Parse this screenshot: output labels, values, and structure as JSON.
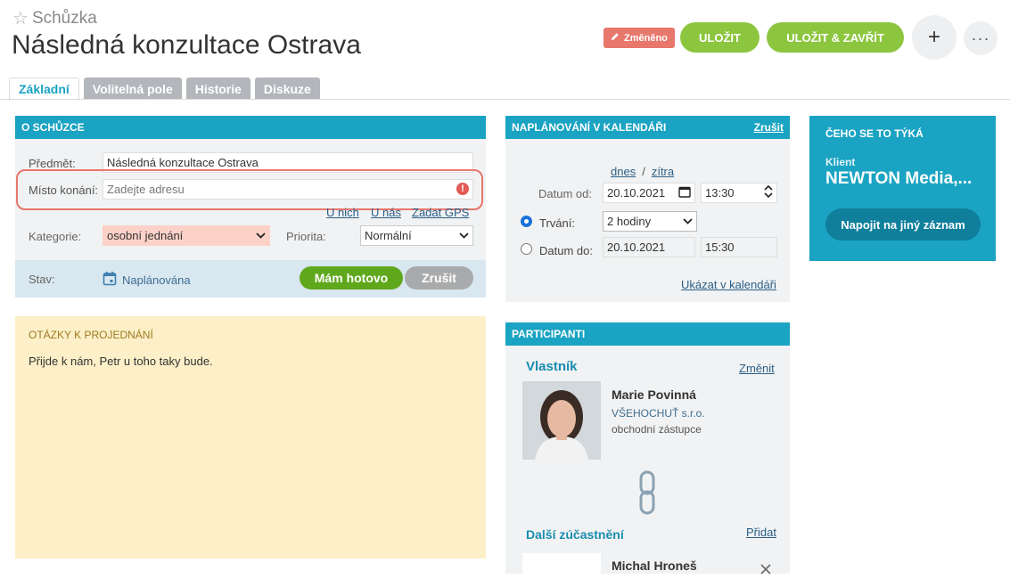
{
  "header": {
    "entity_type": "Schůzka",
    "title": "Následná konzultace Ostrava",
    "changed_badge": "Změněno",
    "save_label": "ULOŽIT",
    "save_close_label": "ULOŽIT & ZAVŘÍT",
    "plus_label": "+",
    "more_label": "···"
  },
  "tabs": [
    {
      "label": "Základní",
      "active": true
    },
    {
      "label": "Volitelná pole",
      "active": false
    },
    {
      "label": "Historie",
      "active": false
    },
    {
      "label": "Diskuze",
      "active": false
    }
  ],
  "meeting": {
    "heading": "O SCHŮZCE",
    "subject_label": "Předmět:",
    "subject_value": "Následná konzultace Ostrava",
    "place_label": "Místo konání:",
    "place_placeholder": "Zadejte adresu",
    "place_links": [
      "U nich",
      "U nás",
      "Zadat GPS"
    ],
    "category_label": "Kategorie:",
    "category_value": "osobní jednání",
    "priority_label": "Priorita:",
    "priority_value": "Normální",
    "status_label": "Stav:",
    "status_value": "Naplánována",
    "done_label": "Mám hotovo",
    "cancel_label": "Zrušit"
  },
  "notes": {
    "heading": "OTÁZKY K PROJEDNÁNÍ",
    "text": "Přijde k nám, Petr u toho taky bude."
  },
  "calendar": {
    "heading": "NAPLÁNOVÁNÍ V KALENDÁŘI",
    "cancel_link": "Zrušit",
    "today_link": "dnes",
    "separator": "/",
    "tomorrow_link": "zítra",
    "date_from_label": "Datum od:",
    "date_from": "20.10.2021",
    "time_from": "13:30",
    "duration_label": "Trvání:",
    "duration_value": "2 hodiny",
    "date_to_label": "Datum do:",
    "date_to": "20.10.2021",
    "time_to": "15:30",
    "show_in_calendar": "Ukázat v kalendáři"
  },
  "participants": {
    "heading": "PARTICIPANTI",
    "owner_label": "Vlastník",
    "change_link": "Změnit",
    "owner_name": "Marie Povinná",
    "owner_company": "VŠEHOCHUŤ s.r.o.",
    "owner_role": "obchodní zástupce",
    "others_label": "Další zúčastnění",
    "add_link": "Přidat",
    "other_name": "Michal Hroneš"
  },
  "related": {
    "heading": "ČEHO SE TO TÝKÁ",
    "type": "Klient",
    "name": "NEWTON Media,...",
    "link_button": "Napojit na jiný záznam"
  },
  "colors": {
    "accent": "#1aa3c2",
    "save_green": "#8cc63f",
    "done_green": "#5fa81c",
    "changed_red": "#e8776c",
    "notes_bg": "#fdf0c8",
    "highlight_outline": "#e8776c"
  }
}
